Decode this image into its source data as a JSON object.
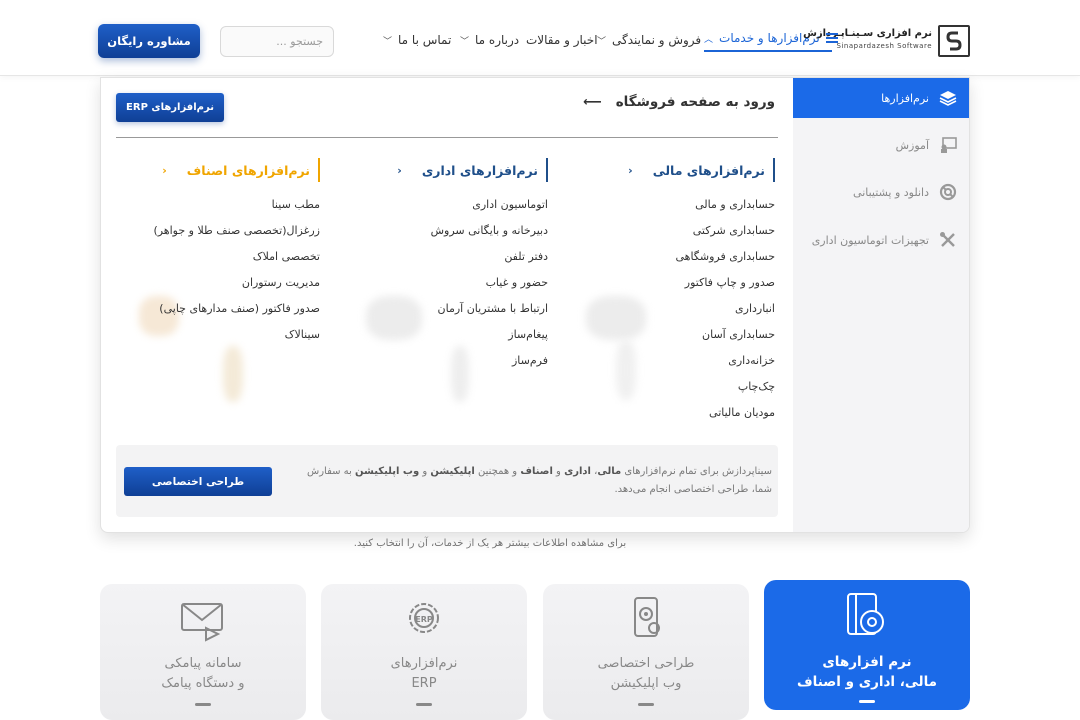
{
  "header": {
    "logo_fa": "نرم افزاری سـینـاپـردازش",
    "logo_en": "Sinapardazesh Software",
    "nav": [
      {
        "label": "نرم‌افزارها و خدمات",
        "active": true
      },
      {
        "label": "فروش و نمایندگی"
      },
      {
        "label": "اخبار و مقالات"
      },
      {
        "label": "درباره ما"
      },
      {
        "label": "تماس با ما"
      }
    ],
    "search_placeholder": "جستجو ...",
    "cta_label": "مشاوره رایگان"
  },
  "mega_menu": {
    "sidebar": [
      {
        "label": "نرم‌افزارها",
        "icon": "layers-icon",
        "active": true
      },
      {
        "label": "آموزش",
        "icon": "teaching-icon"
      },
      {
        "label": "دانلود و پشتیبانی",
        "icon": "support-icon"
      },
      {
        "label": "تجهیزات اتوماسیون اداری",
        "icon": "tools-icon"
      }
    ],
    "shop_link": "ورود به صفحه فروشگاه",
    "erp_button": "نرم‌افزارهای ERP",
    "columns": [
      {
        "title": "نرم‌افزارهای مالی",
        "color": "#1f4f8a",
        "items": [
          "حسابداری و مالی",
          "حسابداری شرکتی",
          "حسابداری فروشگاهی",
          "صدور و چاپ فاکتور",
          "انبارداری",
          "حسابداری آسان",
          "خزانه‌داری",
          "چک‌چاپ",
          "مودیان مالیاتی"
        ]
      },
      {
        "title": "نرم‌افزارهای اداری",
        "color": "#1f4f8a",
        "items": [
          "اتوماسیون اداری",
          "دبیرخانه و بایگانی سروش",
          "دفتر تلفن",
          "حضور و غیاب",
          "ارتباط با مشتریان آرمان",
          "پیغام‌ساز",
          "فرم‌ساز"
        ]
      },
      {
        "title": "نرم‌افزارهای اصناف",
        "color": "#f0a500",
        "items": [
          "مطب سینا",
          "زرغزال(تخصصی صنف طلا و جواهر)",
          "تخصصی املاک",
          "مدیریت رستوران",
          "صدور فاکتور (صنف مدارهای چاپی)",
          "سینالاک"
        ]
      }
    ],
    "info": {
      "t1": "سیناپردازش برای تمام نرم‌افزارهای ",
      "b1": "مالی",
      "t2": "، ",
      "b2": "اداری",
      "t3": " و ",
      "b3": "اصناف",
      "t4": " و همچنین ",
      "b4": "اپلیکیشن",
      "t5": " و ",
      "b5": "وب اپلیکیشن",
      "t6": " به سفارش شما، طراحی اختصاصی انجام می‌دهد.",
      "button": "طراحی اختصاصی"
    }
  },
  "page": {
    "subtitle": "برای مشاهده اطلاعات بیشتر هر یک از خدمات، آن را انتخاب کنید.",
    "cards": [
      {
        "line1": "نرم افزارهای",
        "line2": "مالی، اداری و اصناف",
        "icon": "software-box-icon",
        "active": true
      },
      {
        "line1": "طراحی اختصاصی",
        "line2": "وب اپلیکیشن",
        "icon": "app-design-icon"
      },
      {
        "line1": "نرم‌افزارهای",
        "line2": "ERP",
        "icon": "erp-gear-icon"
      },
      {
        "line1": "سامانه پیامکی",
        "line2": "و دستگاه پیامک",
        "icon": "sms-icon"
      }
    ]
  },
  "colors": {
    "primary": "#1b6ae8",
    "dark_blue": "#0f3f95",
    "gold": "#f0a500"
  }
}
